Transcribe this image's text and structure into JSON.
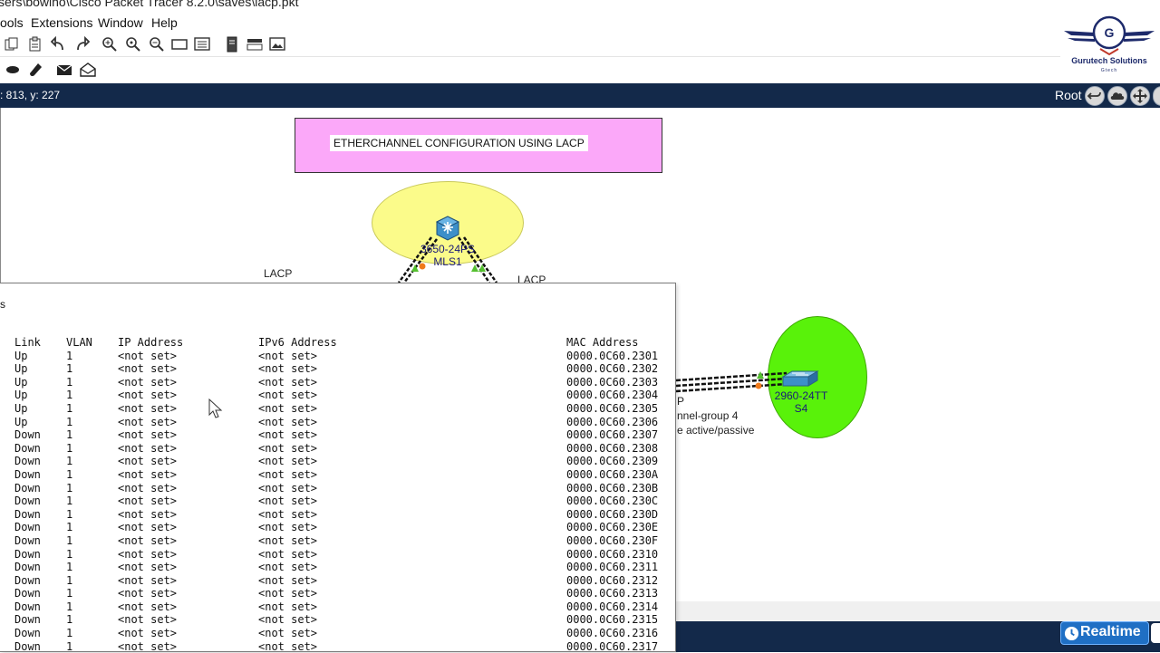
{
  "window": {
    "title": "sers\\bowino\\Cisco Packet Tracer 8.2.0\\saves\\lacp.pkt"
  },
  "menu": {
    "items": [
      "ools",
      "Extensions",
      "Window",
      "Help"
    ]
  },
  "toolbar": {
    "row1_icons": [
      "copy-icon",
      "paste-icon",
      "undo-icon",
      "redo-icon",
      "zoom-in-icon",
      "zoom-reset-icon",
      "zoom-out-icon",
      "drawing-palette-icon",
      "custom-device-icon",
      "notes-icon",
      "device-list-icon",
      "image-icon"
    ],
    "row2_icons": [
      "freeform-shape-icon",
      "paint-icon",
      "simple-pdu-icon",
      "complex-pdu-icon"
    ]
  },
  "status": {
    "coords": ": 813, y: 227",
    "root_label": "Root"
  },
  "logo": {
    "initial": "G",
    "name": "Gurutech Solutions",
    "sub": "Gtech"
  },
  "canvas": {
    "title_note": "ETHERCHANNEL CONFIGURATION USING LACP",
    "mls1": {
      "model": "3650-24PS",
      "name": "MLS1"
    },
    "s4": {
      "model": "2960-24TT",
      "name": "S4"
    },
    "lacp_left": "LACP",
    "lacp_right": "LACP",
    "note_p": "P",
    "note_channel_group": "nnel-group 4",
    "note_mode": "e active/passive"
  },
  "bottom": {
    "realtime_label": "Realtime"
  },
  "popup": {
    "title": "s",
    "columns": {
      "link": "Link",
      "vlan": "VLAN",
      "ip": "IP Address",
      "ipv6": "IPv6 Address",
      "mac": "MAC Address"
    },
    "rows": [
      {
        "link": "Up",
        "vlan": "1",
        "ip": "<not set>",
        "ipv6": "<not set>",
        "mac": "0000.0C60.2301"
      },
      {
        "link": "Up",
        "vlan": "1",
        "ip": "<not set>",
        "ipv6": "<not set>",
        "mac": "0000.0C60.2302"
      },
      {
        "link": "Up",
        "vlan": "1",
        "ip": "<not set>",
        "ipv6": "<not set>",
        "mac": "0000.0C60.2303"
      },
      {
        "link": "Up",
        "vlan": "1",
        "ip": "<not set>",
        "ipv6": "<not set>",
        "mac": "0000.0C60.2304"
      },
      {
        "link": "Up",
        "vlan": "1",
        "ip": "<not set>",
        "ipv6": "<not set>",
        "mac": "0000.0C60.2305"
      },
      {
        "link": "Up",
        "vlan": "1",
        "ip": "<not set>",
        "ipv6": "<not set>",
        "mac": "0000.0C60.2306"
      },
      {
        "link": "Down",
        "vlan": "1",
        "ip": "<not set>",
        "ipv6": "<not set>",
        "mac": "0000.0C60.2307"
      },
      {
        "link": "Down",
        "vlan": "1",
        "ip": "<not set>",
        "ipv6": "<not set>",
        "mac": "0000.0C60.2308"
      },
      {
        "link": "Down",
        "vlan": "1",
        "ip": "<not set>",
        "ipv6": "<not set>",
        "mac": "0000.0C60.2309"
      },
      {
        "link": "Down",
        "vlan": "1",
        "ip": "<not set>",
        "ipv6": "<not set>",
        "mac": "0000.0C60.230A"
      },
      {
        "link": "Down",
        "vlan": "1",
        "ip": "<not set>",
        "ipv6": "<not set>",
        "mac": "0000.0C60.230B"
      },
      {
        "link": "Down",
        "vlan": "1",
        "ip": "<not set>",
        "ipv6": "<not set>",
        "mac": "0000.0C60.230C"
      },
      {
        "link": "Down",
        "vlan": "1",
        "ip": "<not set>",
        "ipv6": "<not set>",
        "mac": "0000.0C60.230D"
      },
      {
        "link": "Down",
        "vlan": "1",
        "ip": "<not set>",
        "ipv6": "<not set>",
        "mac": "0000.0C60.230E"
      },
      {
        "link": "Down",
        "vlan": "1",
        "ip": "<not set>",
        "ipv6": "<not set>",
        "mac": "0000.0C60.230F"
      },
      {
        "link": "Down",
        "vlan": "1",
        "ip": "<not set>",
        "ipv6": "<not set>",
        "mac": "0000.0C60.2310"
      },
      {
        "link": "Down",
        "vlan": "1",
        "ip": "<not set>",
        "ipv6": "<not set>",
        "mac": "0000.0C60.2311"
      },
      {
        "link": "Down",
        "vlan": "1",
        "ip": "<not set>",
        "ipv6": "<not set>",
        "mac": "0000.0C60.2312"
      },
      {
        "link": "Down",
        "vlan": "1",
        "ip": "<not set>",
        "ipv6": "<not set>",
        "mac": "0000.0C60.2313"
      },
      {
        "link": "Down",
        "vlan": "1",
        "ip": "<not set>",
        "ipv6": "<not set>",
        "mac": "0000.0C60.2314"
      },
      {
        "link": "Down",
        "vlan": "1",
        "ip": "<not set>",
        "ipv6": "<not set>",
        "mac": "0000.0C60.2315"
      },
      {
        "link": "Down",
        "vlan": "1",
        "ip": "<not set>",
        "ipv6": "<not set>",
        "mac": "0000.0C60.2316"
      },
      {
        "link": "Down",
        "vlan": "1",
        "ip": "<not set>",
        "ipv6": "<not set>",
        "mac": "0000.0C60.2317"
      }
    ]
  }
}
